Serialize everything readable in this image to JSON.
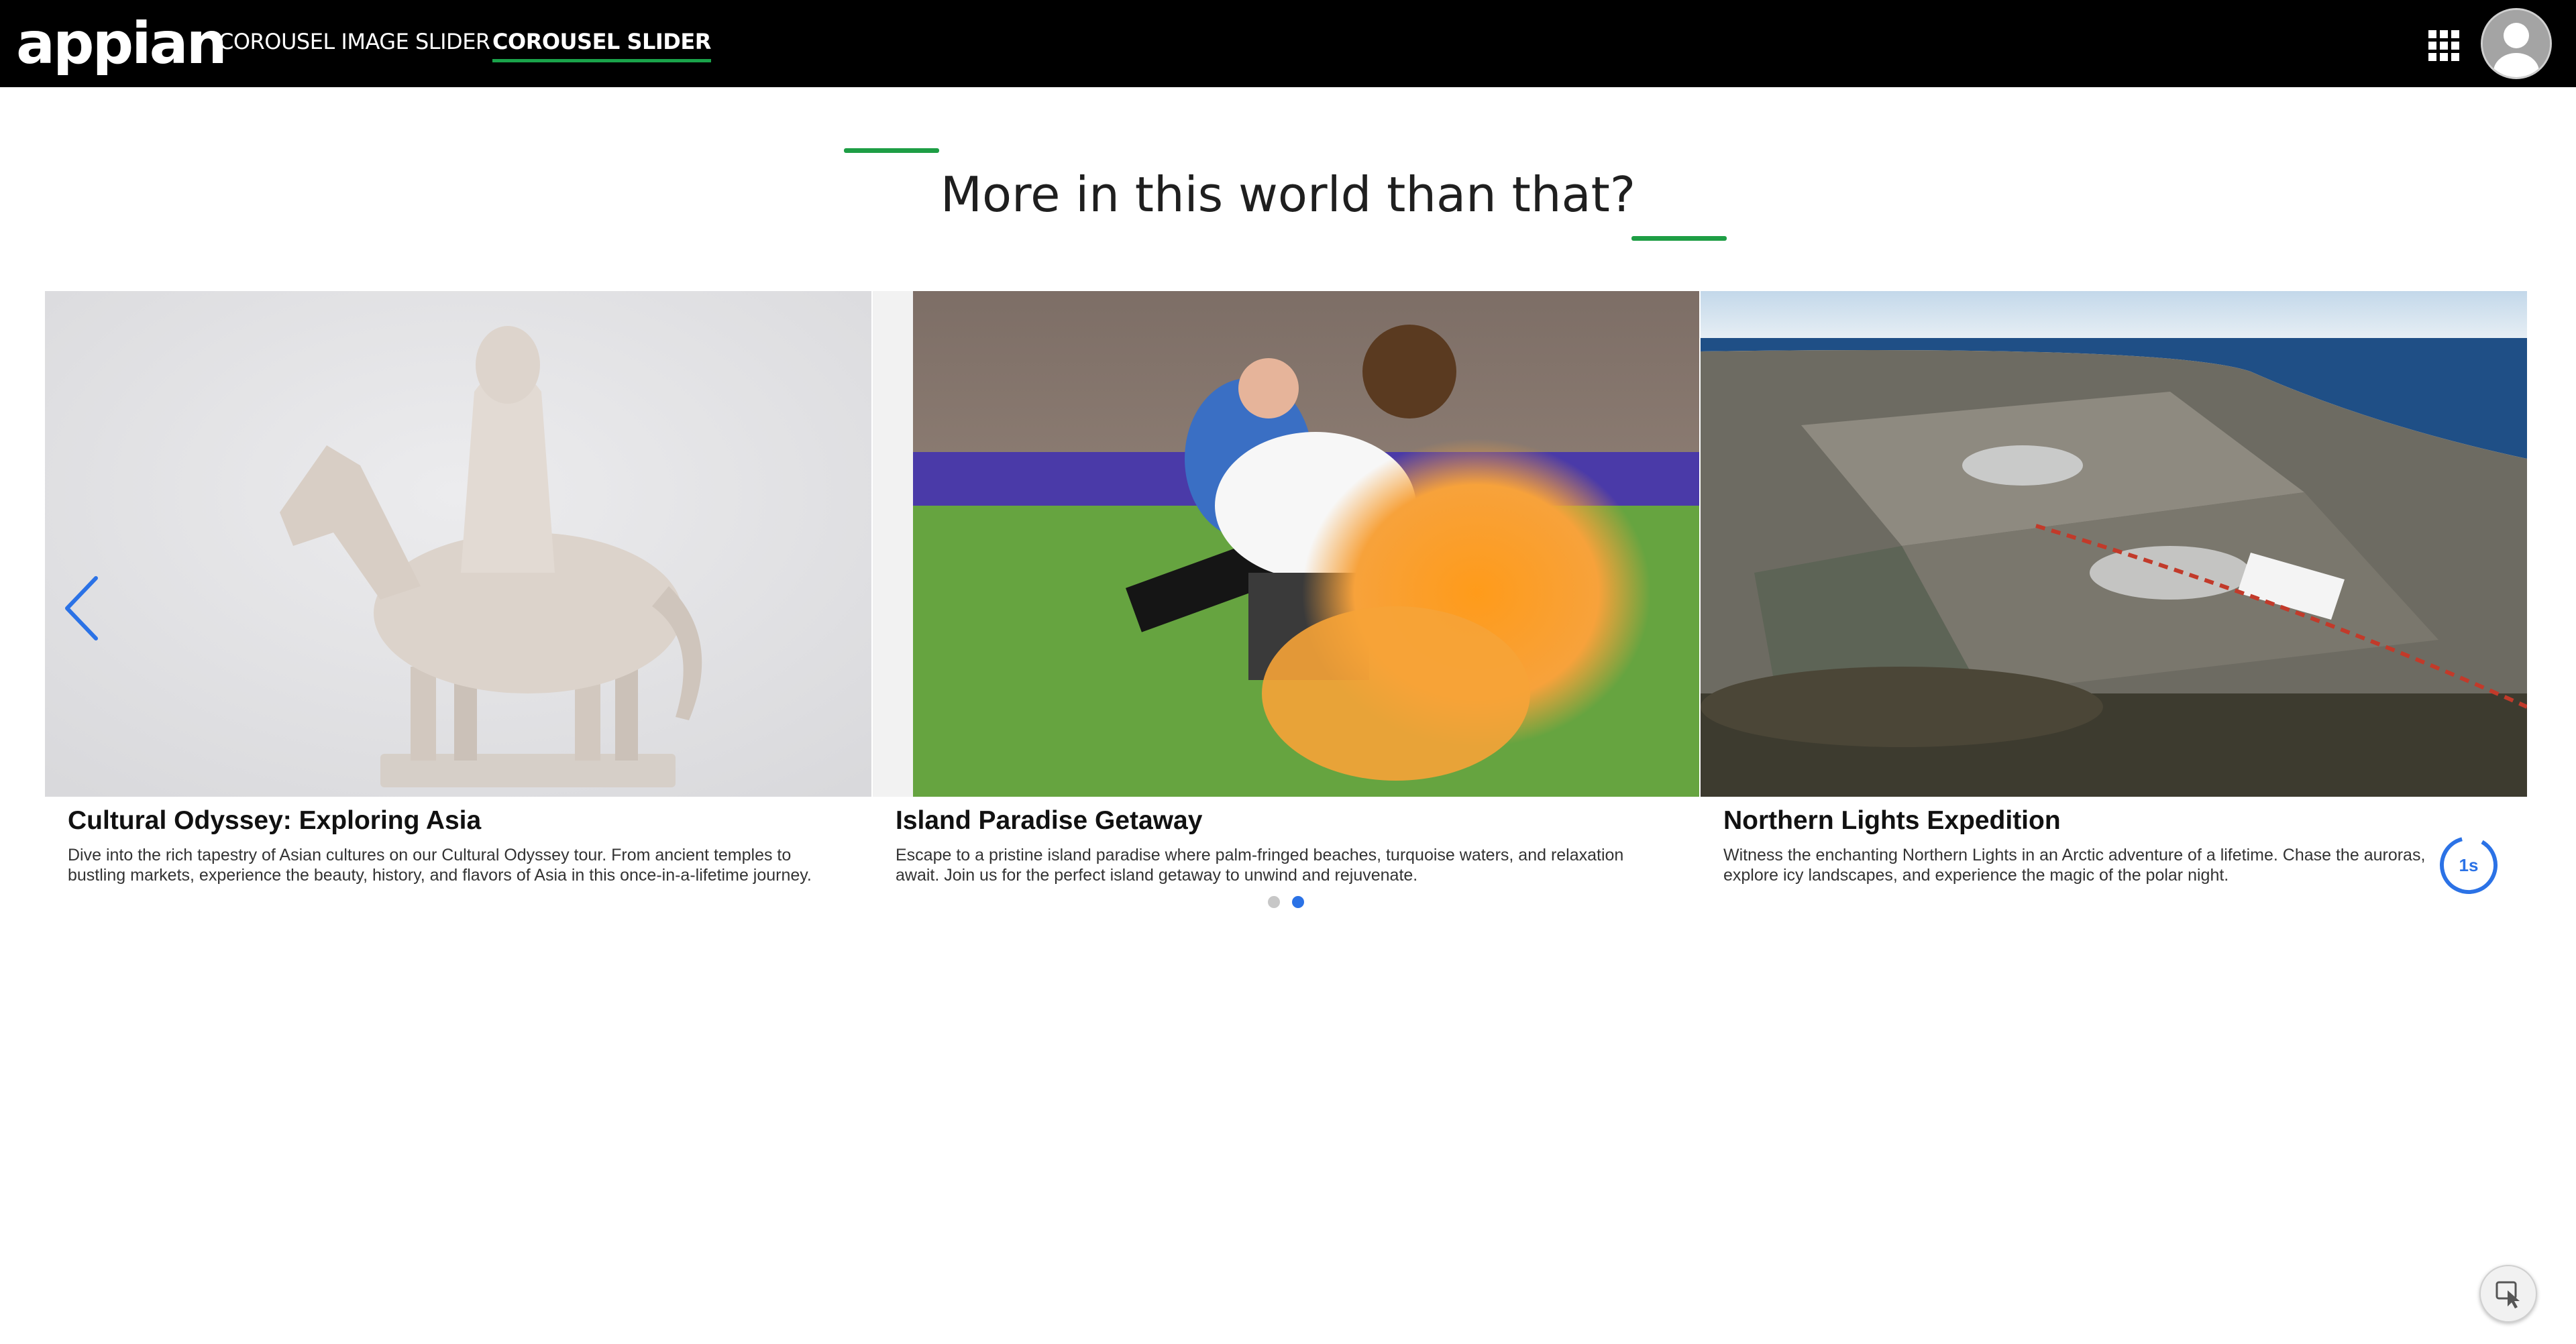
{
  "header": {
    "logo_text": "appian",
    "tabs": [
      {
        "label": "COROUSEL IMAGE SLIDER",
        "active": false
      },
      {
        "label": "COROUSEL SLIDER",
        "active": true
      }
    ],
    "apps_icon": "grid-apps-icon",
    "avatar_icon": "user-avatar-icon"
  },
  "main": {
    "title": "More in this world than that?",
    "accent_color": "#1e9e45"
  },
  "carousel": {
    "slides": [
      {
        "title": "Cultural Odyssey: Exploring Asia",
        "description": "Dive into the rich tapestry of Asian cultures on our Cultural Odyssey tour. From ancient temples to bustling markets, experience the beauty, history, and flavors of Asia in this once-in-a-lifetime journey.",
        "image": "ceramic-horse-rider-figurine"
      },
      {
        "title": "Island Paradise Getaway",
        "description": "Escape to a pristine island paradise where palm-fringed beaches, turquoise waters, and relaxation await. Join us for the perfect island getaway to unwind and rejuvenate.",
        "image": "cricket-field-orange-powder"
      },
      {
        "title": "Northern Lights Expedition",
        "description": "Witness the enchanting Northern Lights in an Arctic adventure of a lifetime. Chase the auroras, explore icy landscapes, and experience the magic of the polar night.",
        "image": "aerial-coastal-construction-site"
      }
    ],
    "prev_icon": "chevron-left-icon",
    "page_count": 2,
    "active_page": 2,
    "timer_label": "1s",
    "accent_color": "#2b72e6"
  },
  "floating_tool": {
    "icon": "cursor-select-icon"
  }
}
